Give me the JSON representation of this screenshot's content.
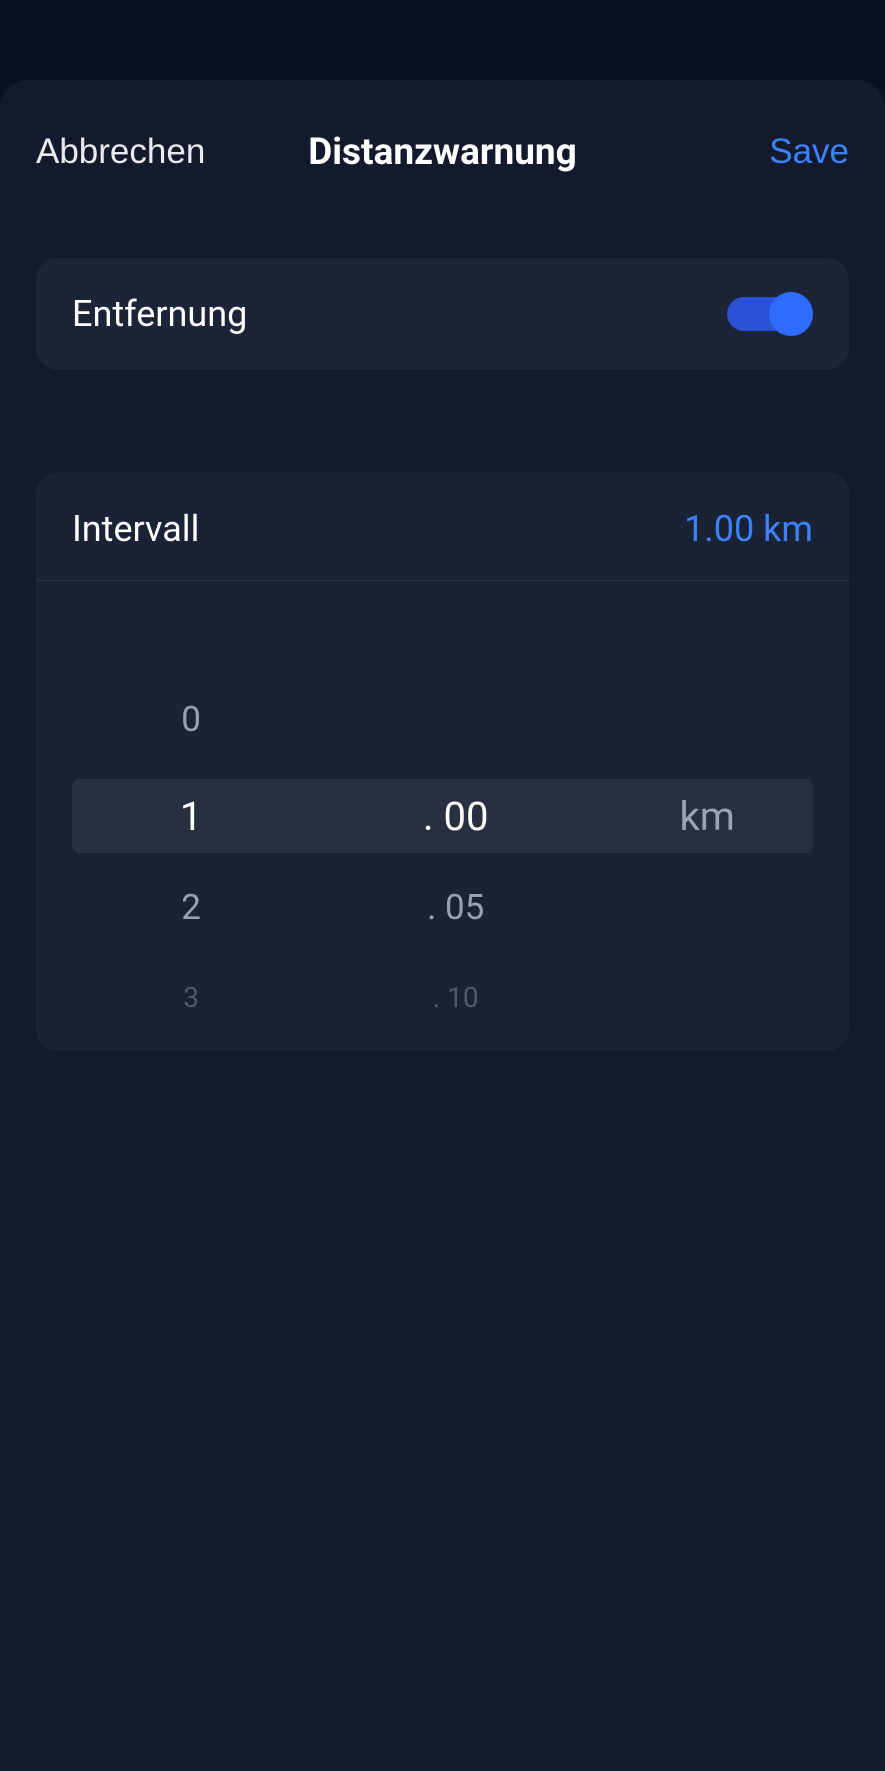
{
  "header": {
    "cancel": "Abbrechen",
    "title": "Distanzwarnung",
    "save": "Save"
  },
  "toggle": {
    "label": "Entfernung",
    "enabled": true
  },
  "interval": {
    "label": "Intervall",
    "value": "1.00 km"
  },
  "picker": {
    "integer": {
      "minus1": "0",
      "selected": "1",
      "plus1": "2",
      "plus2": "3"
    },
    "decimal": {
      "selected": ". 00",
      "plus1": ". 05",
      "plus2": ". 10"
    },
    "unit": {
      "selected": "km"
    }
  }
}
